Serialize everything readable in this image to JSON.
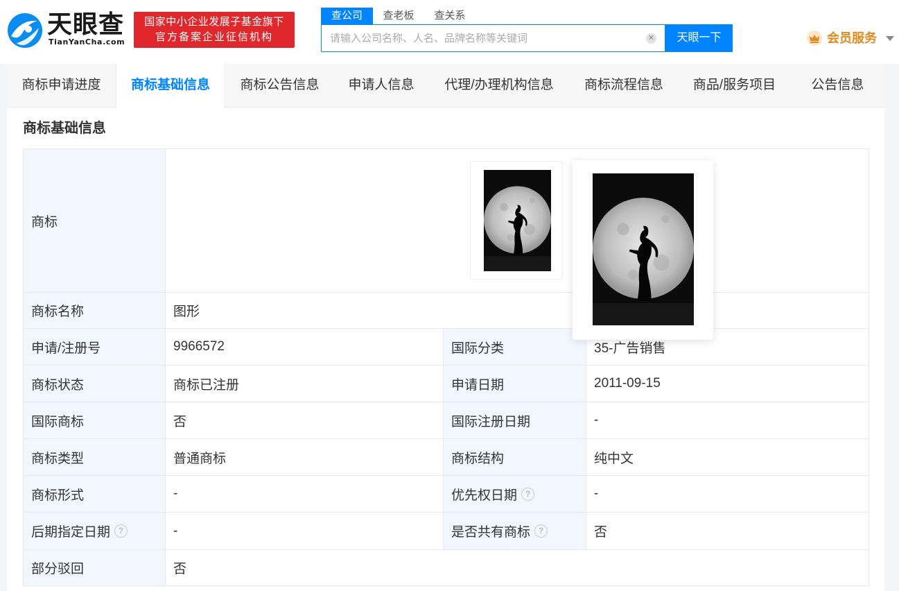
{
  "header": {
    "logo_cn": "天眼查",
    "logo_en": "TianYanCha.com",
    "slogan_line1": "国家中小企业发展子基金旗下",
    "slogan_line2": "官方备案企业征信机构",
    "search_tabs": [
      "查公司",
      "查老板",
      "查关系"
    ],
    "search_placeholder": "请输入公司名称、人名、品牌名称等关键词",
    "search_button": "天眼一下",
    "vip_label": "会员服务"
  },
  "tabs": [
    "商标申请进度",
    "商标基础信息",
    "商标公告信息",
    "申请人信息",
    "代理/办理机构信息",
    "商标流程信息",
    "商品/服务项目",
    "公告信息"
  ],
  "active_tab": "商标基础信息",
  "section_title": "商标基础信息",
  "table": {
    "trademark_label": "商标",
    "rows": [
      {
        "label": "商标名称",
        "value": "图形"
      },
      {
        "label": "申请/注册号",
        "value": "9966572",
        "label2": "国际分类",
        "value2": "35-广告销售"
      },
      {
        "label": "商标状态",
        "value": "商标已注册",
        "label2": "申请日期",
        "value2": "2011-09-15"
      },
      {
        "label": "国际商标",
        "value": "否",
        "label2": "国际注册日期",
        "value2": "-"
      },
      {
        "label": "商标类型",
        "value": "普通商标",
        "label2": "商标结构",
        "value2": "纯中文"
      },
      {
        "label": "商标形式",
        "value": "-",
        "label2": "优先权日期",
        "value2": "-"
      },
      {
        "label": "后期指定日期",
        "value": "-",
        "label2": "是否共有商标",
        "value2": "否"
      },
      {
        "label": "部分驳回",
        "value": "否"
      }
    ]
  },
  "colors": {
    "accent": "#0084ff",
    "slogan_bg": "#e0272c",
    "header_cell_bg": "#f2f7ff",
    "vip": "#e08a1e"
  }
}
